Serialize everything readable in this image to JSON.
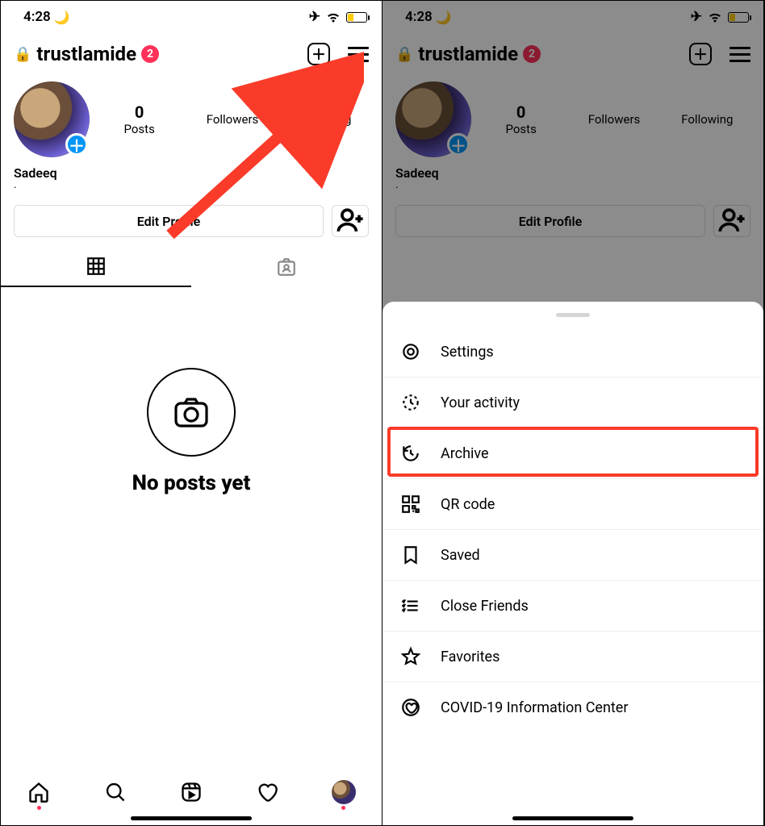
{
  "status": {
    "time": "4:28"
  },
  "profile": {
    "username": "trustlamide",
    "notification_count": "2",
    "display_name": "Sadeeq",
    "bio": ".",
    "stats": {
      "posts_num": "0",
      "posts_label": "Posts",
      "followers_num": "",
      "followers_label": "Followers",
      "following_num": "",
      "following_label": "Following"
    },
    "edit_profile_label": "Edit Profile",
    "empty_message": "No posts yet"
  },
  "menu": {
    "items": [
      {
        "label": "Settings"
      },
      {
        "label": "Your activity"
      },
      {
        "label": "Archive"
      },
      {
        "label": "QR code"
      },
      {
        "label": "Saved"
      },
      {
        "label": "Close Friends"
      },
      {
        "label": "Favorites"
      },
      {
        "label": "COVID-19 Information Center"
      }
    ]
  }
}
